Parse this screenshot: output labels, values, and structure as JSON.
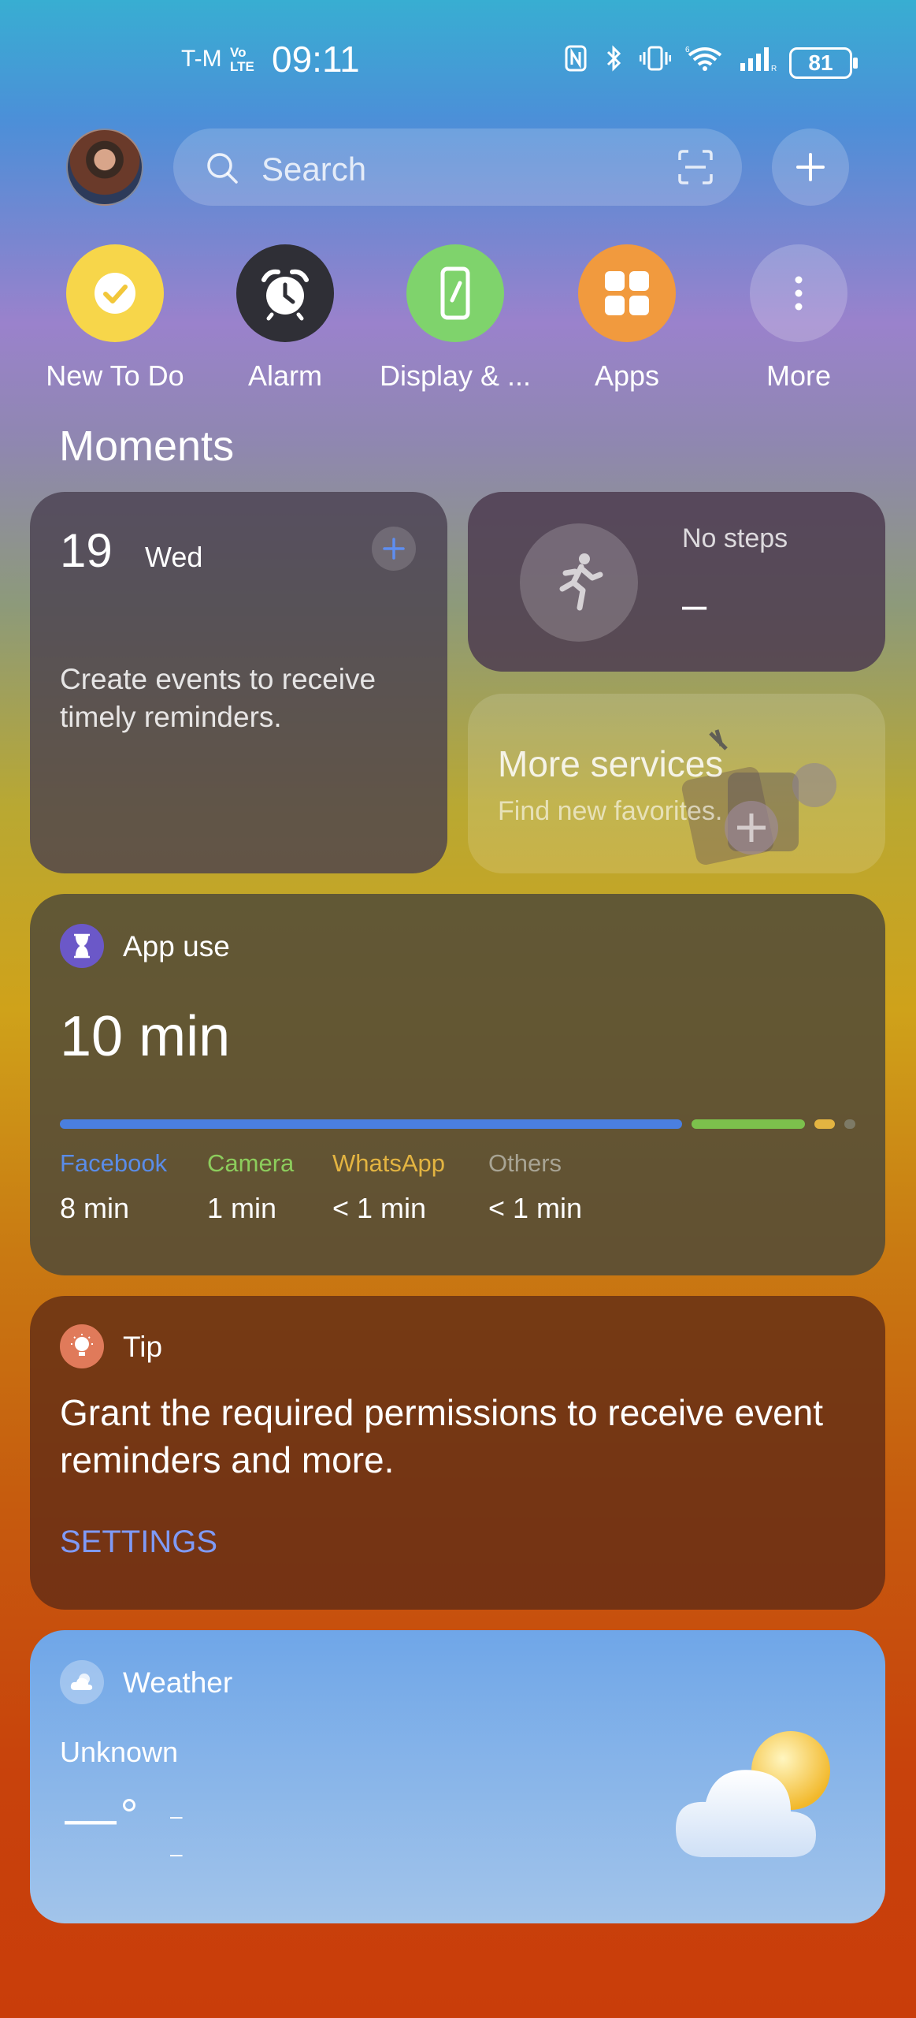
{
  "status_bar": {
    "carrier": "T-M",
    "volte_top": "Vo",
    "volte_bottom": "LTE",
    "time": "09:11",
    "battery": "81",
    "icons": [
      "nfc-icon",
      "bluetooth-icon",
      "vibrate-icon",
      "wifi-6-icon",
      "signal-icon"
    ]
  },
  "search": {
    "placeholder": "Search"
  },
  "quick_actions": [
    {
      "label": "New To Do",
      "icon": "check-icon",
      "color": "#f7d64a"
    },
    {
      "label": "Alarm",
      "icon": "alarm-clock-icon",
      "color": "#2f2f36"
    },
    {
      "label": "Display & ...",
      "icon": "phone-display-icon",
      "color": "#7fd36c"
    },
    {
      "label": "Apps",
      "icon": "apps-grid-icon",
      "color": "#f19a3e"
    },
    {
      "label": "More",
      "icon": "more-vertical-icon",
      "color": "rgba(255,255,255,0.2)"
    }
  ],
  "moments": {
    "title": "Moments",
    "calendar": {
      "day": "19",
      "weekday": "Wed",
      "message": "Create events to receive timely reminders."
    },
    "steps": {
      "title": "No steps",
      "value": "–"
    },
    "services": {
      "title": "More services",
      "subtitle": "Find new favorites."
    }
  },
  "app_use": {
    "title": "App use",
    "total": "10 min",
    "apps": [
      {
        "name": "Facebook",
        "value": "8 min",
        "color": "#4a7fe0"
      },
      {
        "name": "Camera",
        "value": "1 min",
        "color": "#7cc04c"
      },
      {
        "name": "WhatsApp",
        "value": "< 1 min",
        "color": "#e3b441"
      },
      {
        "name": "Others",
        "value": "< 1 min",
        "color": "#9a9a8a"
      }
    ]
  },
  "tip": {
    "title": "Tip",
    "text": "Grant the required permissions to receive event reminders and more.",
    "action": "SETTINGS"
  },
  "weather": {
    "title": "Weather",
    "location": "Unknown",
    "temp": "—",
    "high": "–",
    "low": "–"
  }
}
